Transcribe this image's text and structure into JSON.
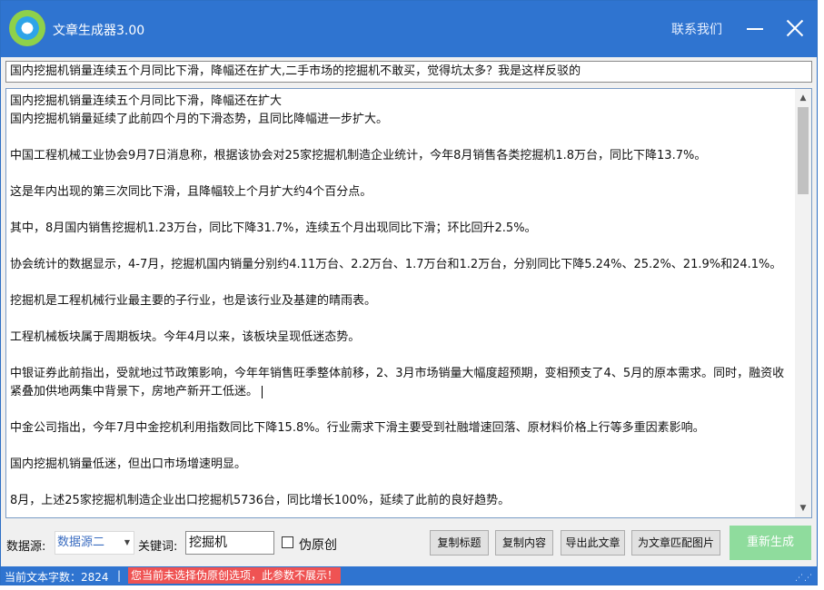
{
  "app": {
    "title": "文章生成器3.00",
    "contact_label": "联系我们"
  },
  "article": {
    "title_value": "国内挖掘机销量连续五个月同比下滑，降幅还在扩大,二手市场的挖掘机不敢买，觉得坑太多？我是这样反驳的",
    "paragraphs": [
      "国内挖掘机销量连续五个月同比下滑，降幅还在扩大",
      "国内挖掘机销量延续了此前四个月的下滑态势，且同比降幅进一步扩大。",
      "中国工程机械工业协会9月7日消息称，根据该协会对25家挖掘机制造企业统计，今年8月销售各类挖掘机1.8万台，同比下降13.7%。",
      "这是年内出现的第三次同比下滑，且降幅较上个月扩大约4个百分点。",
      "其中，8月国内销售挖掘机1.23万台，同比下降31.7%，连续五个月出现同比下滑；环比回升2.5%。",
      "协会统计的数据显示，4-7月，挖掘机国内销量分别约4.11万台、2.2万台、1.7万台和1.2万台，分别同比下降5.24%、25.2%、21.9%和24.1%。",
      "挖掘机是工程机械行业最主要的子行业，也是该行业及基建的晴雨表。",
      "工程机械板块属于周期板块。今年4月以来，该板块呈现低迷态势。",
      "中银证券此前指出，受就地过节政策影响，今年年销售旺季整体前移，2、3月市场销量大幅度超预期，变相预支了4、5月的原本需求。同时，融资收紧叠加供地两集中背景下，房地产新开工低迷。",
      "中金公司指出，今年7月中金挖机利用指数同比下降15.8%。行业需求下滑主要受到社融增速回落、原材料价格上行等多重因素影响。",
      "国内挖掘机销量低迷，但出口市场增速明显。",
      "8月，上述25家挖掘机制造企业出口挖掘机5736台，同比增长100%，延续了此前的良好趋势。"
    ]
  },
  "toolbar": {
    "source_label": "数据源:",
    "source_value": "数据源二",
    "keyword_label": "关键词:",
    "keyword_value": "挖掘机",
    "pseudo_original_label": "伪原创",
    "pseudo_original_checked": false,
    "copy_title_label": "复制标题",
    "copy_content_label": "复制内容",
    "export_label": "导出此文章",
    "match_image_label": "为文章匹配图片",
    "regenerate_label": "重新生成"
  },
  "status": {
    "word_count_label": "当前文本字数：2824",
    "separator": "|",
    "warning": "您当前未选择伪原创选项，此参数不展示！"
  },
  "colors": {
    "titlebar": "#2f74d0",
    "regenerate_button": "#8fdc9d",
    "warning_bg": "#ef5353"
  },
  "icons": [
    "app-logo-icon",
    "minimize-icon",
    "close-icon",
    "dropdown-arrow-icon",
    "scroll-up-icon",
    "scroll-down-icon",
    "resize-grip-icon"
  ]
}
